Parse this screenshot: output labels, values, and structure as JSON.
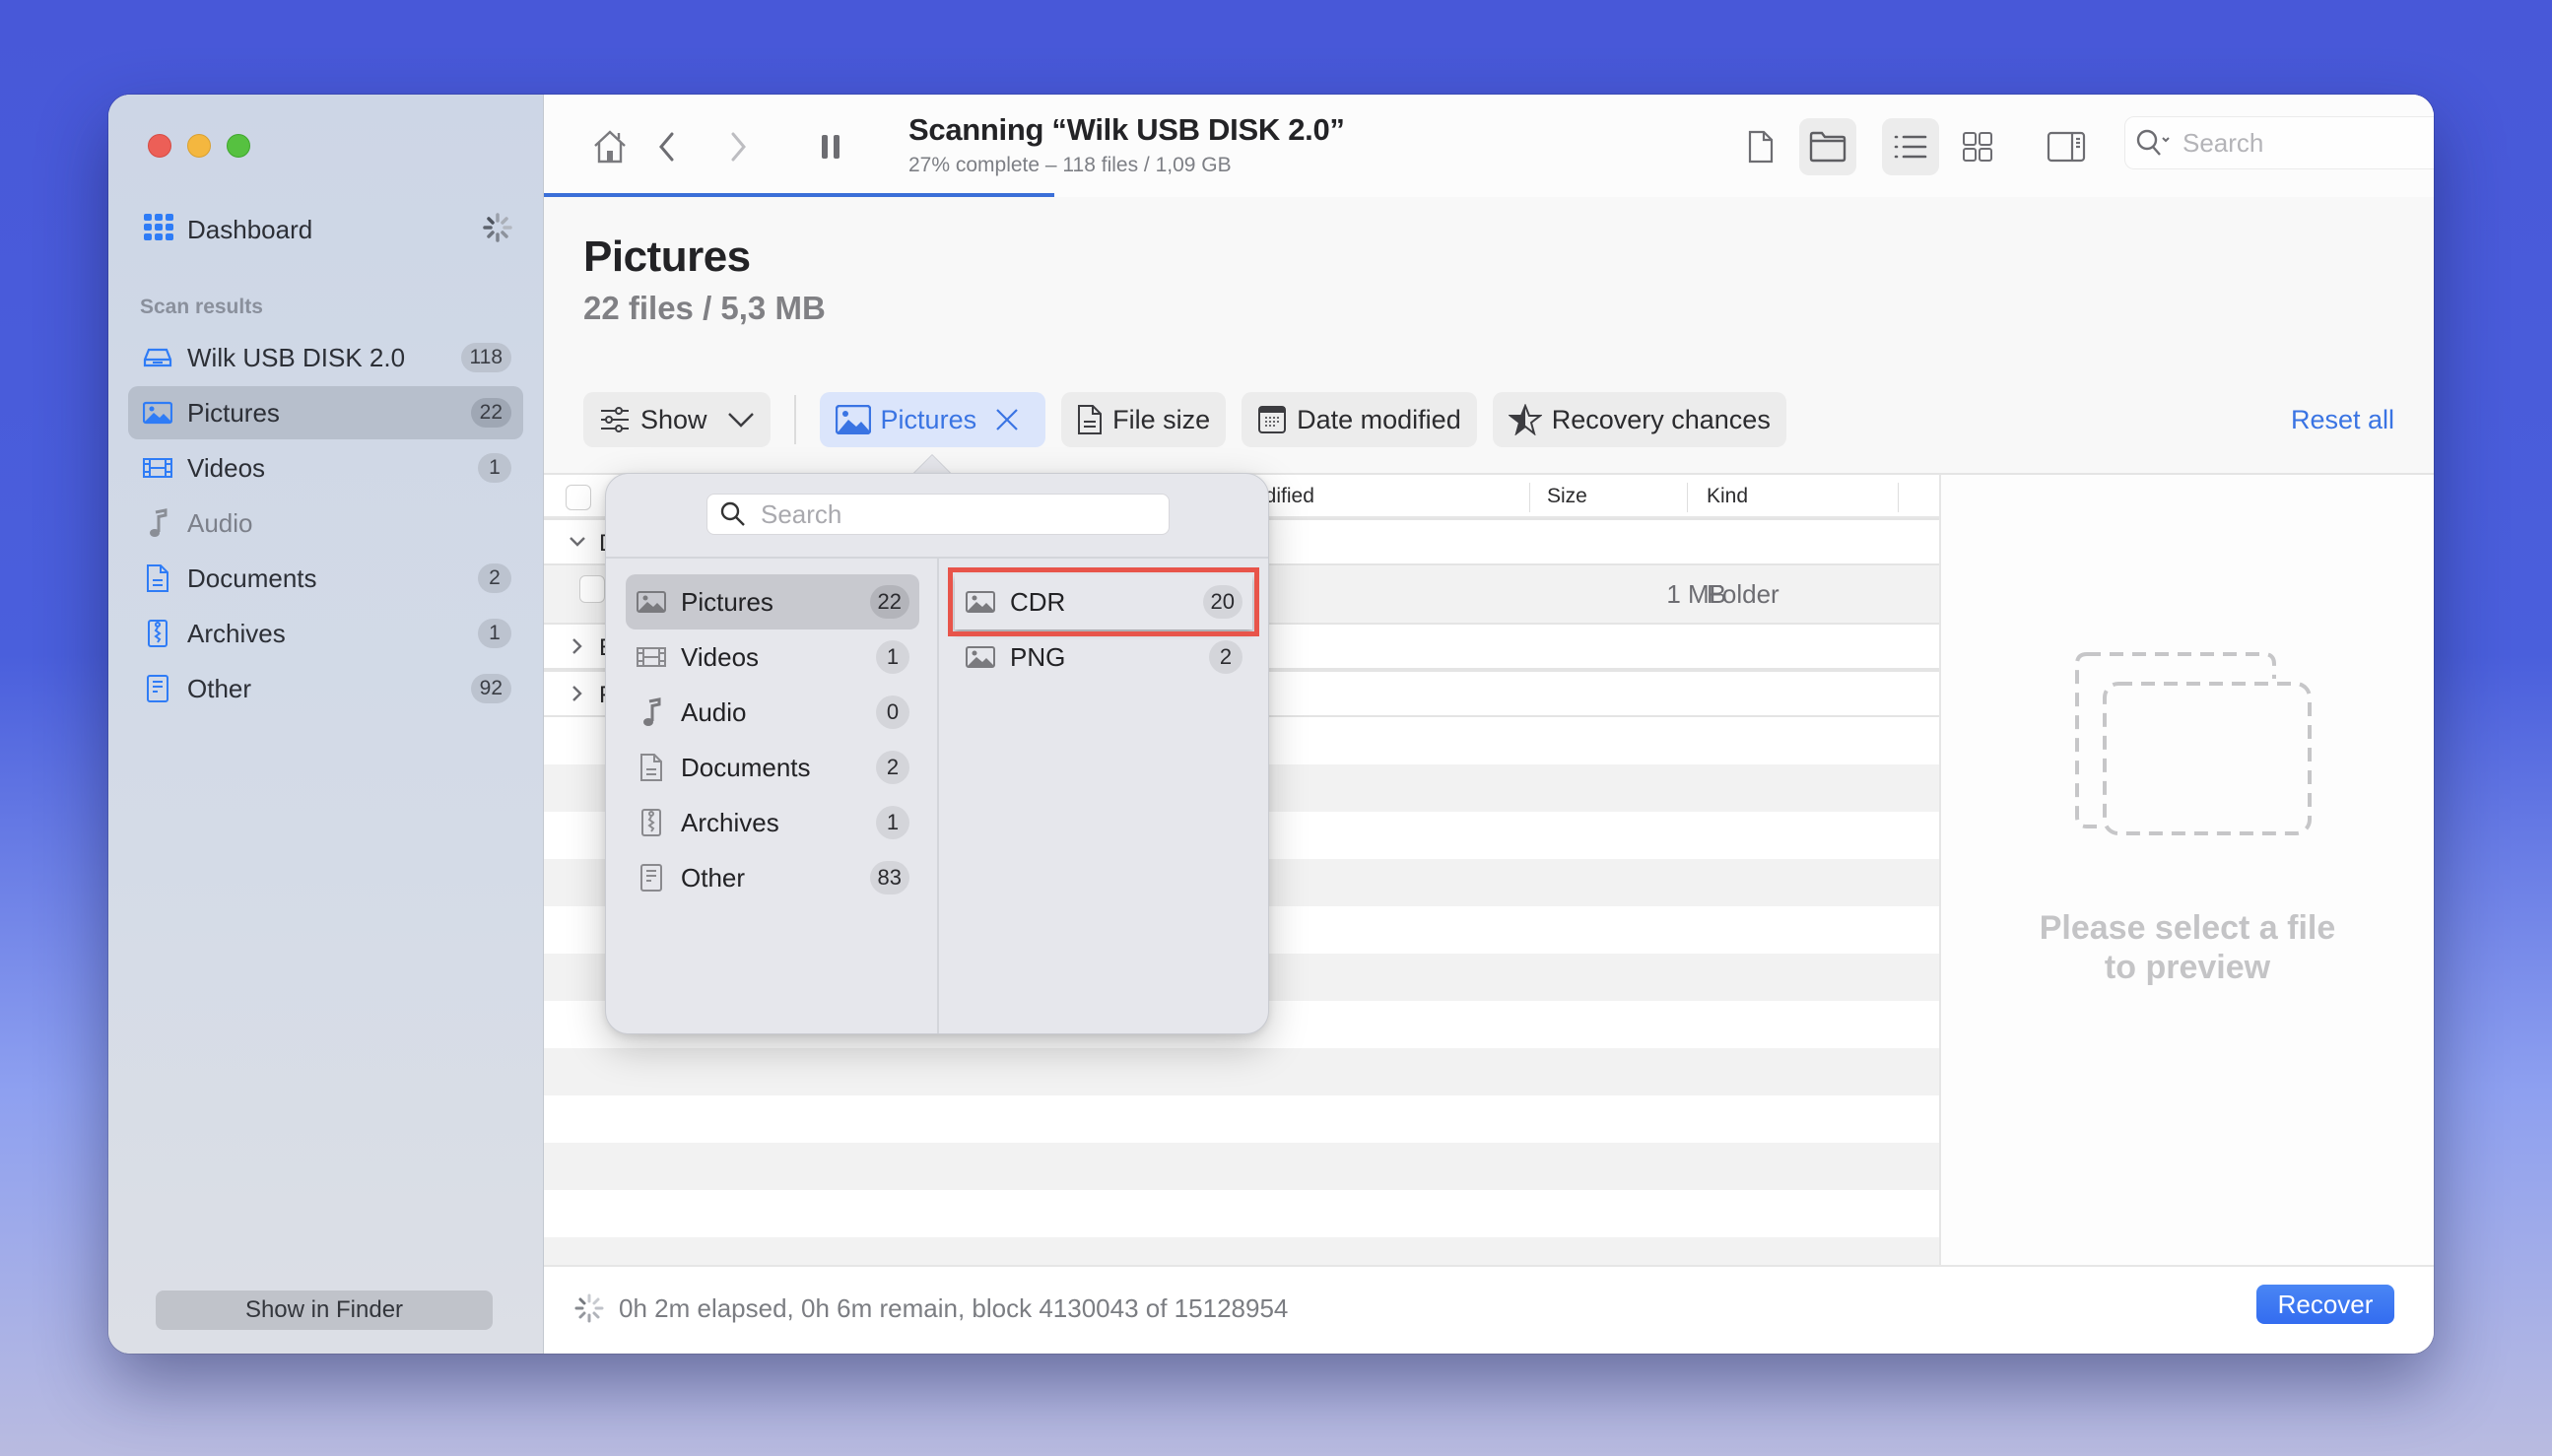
{
  "window": {
    "traffic_lights": [
      "close",
      "minimize",
      "maximize"
    ]
  },
  "sidebar": {
    "dashboard_label": "Dashboard",
    "section_label": "Scan results",
    "items": [
      {
        "label": "Wilk USB DISK 2.0",
        "count": "118",
        "icon": "drive-icon",
        "active": false
      },
      {
        "label": "Pictures",
        "count": "22",
        "icon": "picture-icon",
        "active": true
      },
      {
        "label": "Videos",
        "count": "1",
        "icon": "film-icon",
        "active": false
      },
      {
        "label": "Audio",
        "count": "",
        "icon": "music-note-icon",
        "active": false
      },
      {
        "label": "Documents",
        "count": "2",
        "icon": "document-icon",
        "active": false
      },
      {
        "label": "Archives",
        "count": "1",
        "icon": "archive-icon",
        "active": false
      },
      {
        "label": "Other",
        "count": "92",
        "icon": "other-file-icon",
        "active": false
      }
    ],
    "show_in_finder": "Show in Finder"
  },
  "toolbar": {
    "scan_title": "Scanning “Wilk USB DISK 2.0”",
    "scan_subtitle": "27% complete – 118 files / 1,09 GB",
    "progress_percent": 27,
    "search_placeholder": "Search"
  },
  "page": {
    "title": "Pictures",
    "subtitle": "22 files / 5,3 MB"
  },
  "filters": {
    "show_label": "Show",
    "active_filter": "Pictures",
    "file_size": "File size",
    "date_modified": "Date modified",
    "recovery_chances": "Recovery chances",
    "reset_all": "Reset all"
  },
  "table": {
    "columns": {
      "date_modified_partial": "odified",
      "size": "Size",
      "kind": "Kind"
    },
    "rows": [
      {
        "type": "group",
        "expanded": true,
        "name_fragment": "D"
      },
      {
        "type": "item",
        "size": "1 MB",
        "kind": "Folder"
      },
      {
        "type": "group",
        "expanded": false,
        "name_fragment": "E"
      },
      {
        "type": "group",
        "expanded": false,
        "name_fragment": "F"
      }
    ]
  },
  "preview": {
    "empty_line1": "Please select a file",
    "empty_line2": "to preview"
  },
  "statusbar": {
    "status": "0h 2m elapsed, 0h 6m remain, block 4130043 of 15128954",
    "recover_label": "Recover"
  },
  "popover": {
    "search_placeholder": "Search",
    "categories": [
      {
        "label": "Pictures",
        "count": "22",
        "active": true
      },
      {
        "label": "Videos",
        "count": "1"
      },
      {
        "label": "Audio",
        "count": "0"
      },
      {
        "label": "Documents",
        "count": "2"
      },
      {
        "label": "Archives",
        "count": "1"
      },
      {
        "label": "Other",
        "count": "83"
      }
    ],
    "subtypes": [
      {
        "label": "CDR",
        "count": "20",
        "highlighted": true
      },
      {
        "label": "PNG",
        "count": "2"
      }
    ]
  },
  "colors": {
    "accent": "#3a74e3",
    "progress": "#3b6fd8",
    "highlight_box": "#e8544a"
  }
}
